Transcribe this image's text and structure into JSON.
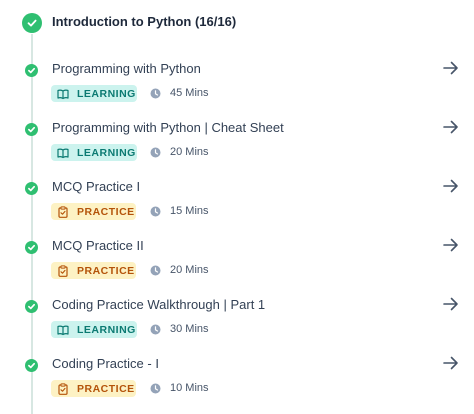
{
  "module": {
    "title": "Introduction to Python (16/16)",
    "status_icon": "check-circle-icon"
  },
  "items": [
    {
      "title": "Programming with Python",
      "type": "LEARNING",
      "type_icon": "book-icon",
      "duration": "45 Mins",
      "nav_icon": "arrow-right-icon"
    },
    {
      "title": "Programming with Python | Cheat Sheet",
      "type": "LEARNING",
      "type_icon": "book-icon",
      "duration": "20 Mins",
      "nav_icon": "arrow-right-icon"
    },
    {
      "title": "MCQ Practice I",
      "type": "PRACTICE",
      "type_icon": "clipboard-icon",
      "duration": "15 Mins",
      "nav_icon": "arrow-right-icon"
    },
    {
      "title": "MCQ Practice II",
      "type": "PRACTICE",
      "type_icon": "clipboard-icon",
      "duration": "20 Mins",
      "nav_icon": "arrow-right-icon"
    },
    {
      "title": "Coding Practice Walkthrough | Part 1",
      "type": "LEARNING",
      "type_icon": "book-icon",
      "duration": "30 Mins",
      "nav_icon": "arrow-right-icon"
    },
    {
      "title": "Coding Practice - I",
      "type": "PRACTICE",
      "type_icon": "clipboard-icon",
      "duration": "10 Mins",
      "nav_icon": "arrow-right-icon"
    }
  ],
  "colors": {
    "complete_green": "#2fbf71",
    "timeline": "#d7e7e2",
    "learning_bg": "#ccf3ee",
    "learning_text": "#0b7a72",
    "practice_bg": "#fdf2c4",
    "practice_text": "#b45309"
  }
}
